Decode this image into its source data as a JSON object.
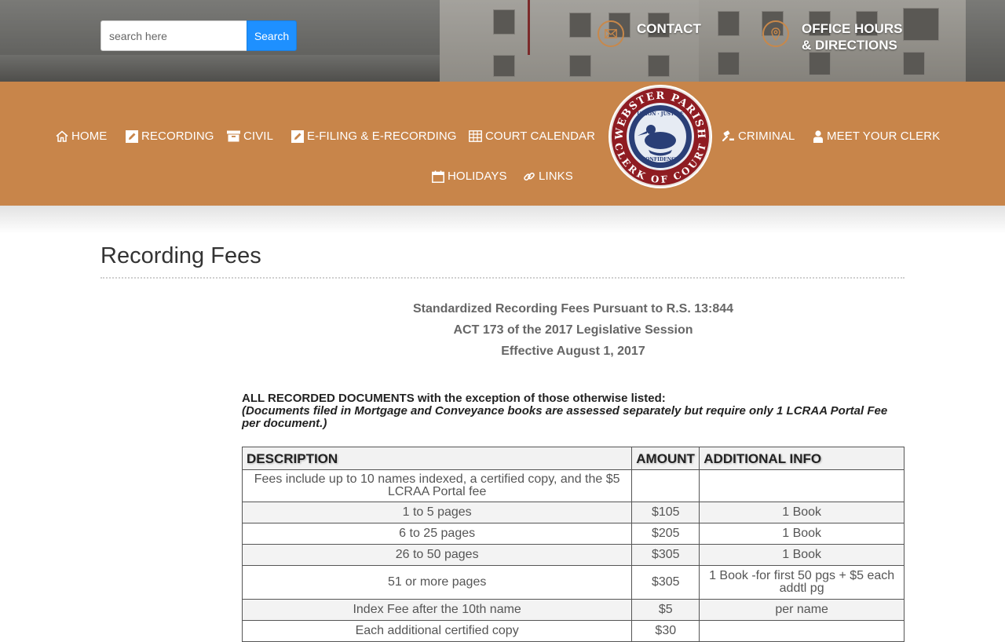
{
  "header": {
    "search_placeholder": "search here",
    "search_button": "Search",
    "contact_label": "CONTACT",
    "hours_line1": "OFFICE HOURS",
    "hours_line2": "& DIRECTIONS"
  },
  "nav": {
    "home": "HOME",
    "recording": "RECORDING",
    "civil": "CIVIL",
    "efiling": "E-FILING & E-RECORDING",
    "court_calendar": "COURT CALENDAR",
    "criminal": "CRIMINAL",
    "meet_clerk": "MEET YOUR CLERK",
    "holidays": "HOLIDAYS",
    "links": "LINKS",
    "seal_top": "WEBSTER PARISH",
    "seal_bottom": "CLERK OF COURT",
    "seal_ribbon_top": "UNION · JUSTICE",
    "seal_ribbon_bottom": "CONFIDENCE"
  },
  "page": {
    "title": "Recording Fees",
    "intro_line1": "Standardized Recording Fees Pursuant to R.S. 13:844",
    "intro_line2": "ACT 173 of the 2017 Legislative Session",
    "intro_line3": "Effective August 1, 2017",
    "note_bold": "ALL RECORDED DOCUMENTS with the exception of those otherwise listed:",
    "note_italic": "(Documents filed in Mortgage and Conveyance books are assessed separately but require only 1 LCRAA Portal Fee per document.)"
  },
  "table": {
    "headers": [
      "DESCRIPTION",
      "AMOUNT",
      "ADDITIONAL INFO"
    ],
    "rows": [
      [
        "Fees include up to 10 names indexed, a certified copy, and the $5 LCRAA Portal fee",
        "",
        ""
      ],
      [
        "1 to 5 pages",
        "$105",
        "1 Book"
      ],
      [
        "6 to 25 pages",
        "$205",
        "1 Book"
      ],
      [
        "26 to 50 pages",
        "$305",
        "1 Book"
      ],
      [
        "51 or more pages",
        "$305",
        "1 Book -for first 50 pgs + $5 each addtl pg"
      ],
      [
        "Index Fee after the 10th name",
        "$5",
        "per name"
      ],
      [
        "Each additional certified copy",
        "$30",
        ""
      ]
    ]
  },
  "colors": {
    "nav_bg": "#c8854a",
    "search_button": "#1e90ff",
    "icon_ring": "#c8884a"
  }
}
